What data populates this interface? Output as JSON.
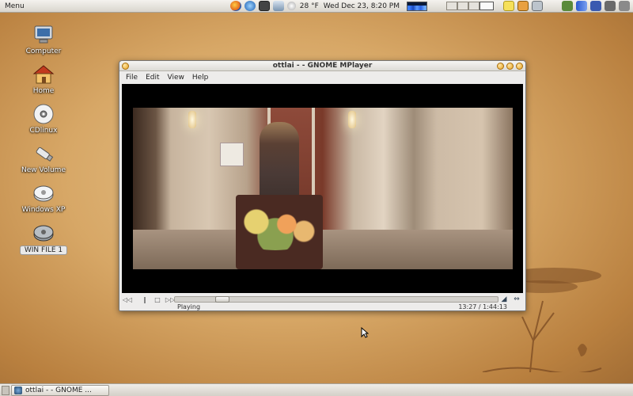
{
  "top_panel": {
    "menu_label": "Menu",
    "weather": "28 °F",
    "clock": "Wed Dec 23,  8:20 PM"
  },
  "desktop_icons": [
    {
      "label": "Computer"
    },
    {
      "label": "Home"
    },
    {
      "label": "CDlinux"
    },
    {
      "label": "New Volume"
    },
    {
      "label": "Windows XP"
    },
    {
      "label": "WIN FILE 1"
    }
  ],
  "window": {
    "title": "ottlai -         - GNOME MPlayer",
    "menus": [
      "File",
      "Edit",
      "View",
      "Help"
    ],
    "status": "Playing",
    "time": "13:27 / 1:44:13",
    "progress_percent": 13
  },
  "taskbar": {
    "task_label": "ottlai -        - GNOME ..."
  }
}
